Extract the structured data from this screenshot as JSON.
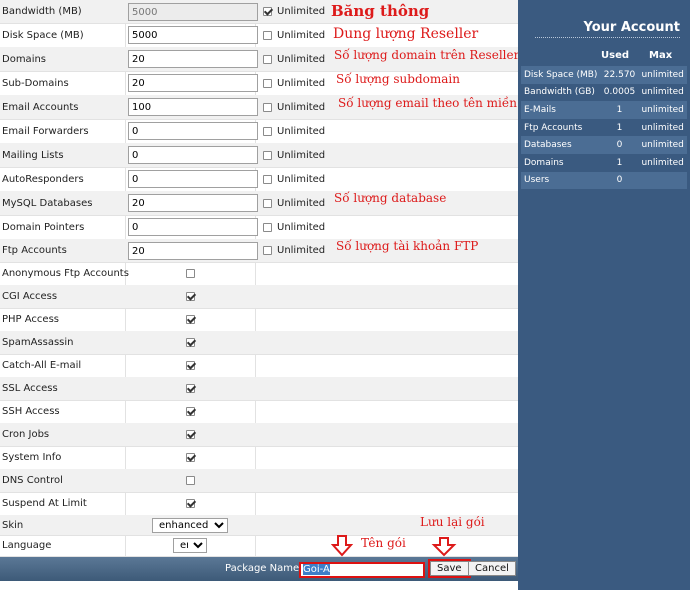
{
  "rows": [
    {
      "label": "Bandwidth (MB)",
      "value": "5000",
      "unlimited": "Unlimited",
      "checked": true,
      "disabled": true
    },
    {
      "label": "Disk Space (MB)",
      "value": "5000",
      "unlimited": "Unlimited",
      "checked": false
    },
    {
      "label": "Domains",
      "value": "20",
      "unlimited": "Unlimited",
      "checked": false
    },
    {
      "label": "Sub-Domains",
      "value": "20",
      "unlimited": "Unlimited",
      "checked": false
    },
    {
      "label": "Email Accounts",
      "value": "100",
      "unlimited": "Unlimited",
      "checked": false
    },
    {
      "label": "Email Forwarders",
      "value": "0",
      "unlimited": "Unlimited",
      "checked": false
    },
    {
      "label": "Mailing Lists",
      "value": "0",
      "unlimited": "Unlimited",
      "checked": false
    },
    {
      "label": "AutoResponders",
      "value": "0",
      "unlimited": "Unlimited",
      "checked": false
    },
    {
      "label": "MySQL Databases",
      "value": "20",
      "unlimited": "Unlimited",
      "checked": false
    },
    {
      "label": "Domain Pointers",
      "value": "0",
      "unlimited": "Unlimited",
      "checked": false
    },
    {
      "label": "Ftp Accounts",
      "value": "20",
      "unlimited": "Unlimited",
      "checked": false
    }
  ],
  "features": [
    {
      "label": "Anonymous Ftp Accounts",
      "checked": false
    },
    {
      "label": "CGI Access",
      "checked": true
    },
    {
      "label": "PHP Access",
      "checked": true
    },
    {
      "label": "SpamAssassin",
      "checked": true
    },
    {
      "label": "Catch-All E-mail",
      "checked": true
    },
    {
      "label": "SSL Access",
      "checked": true
    },
    {
      "label": "SSH Access",
      "checked": true
    },
    {
      "label": "Cron Jobs",
      "checked": true
    },
    {
      "label": "System Info",
      "checked": true
    },
    {
      "label": "DNS Control",
      "checked": false
    },
    {
      "label": "Suspend At Limit",
      "checked": true
    }
  ],
  "skin": {
    "label": "Skin",
    "value": "enhanced"
  },
  "language": {
    "label": "Language",
    "value": "en"
  },
  "bottom": {
    "package_label": "Package Name:",
    "package_value": "Goi-A",
    "save": "Save",
    "cancel": "Cancel"
  },
  "notes": {
    "bandwidth": "Băng thông",
    "disk": "Dung lượng Reseller",
    "domains": "Số lượng domain trên Reseller",
    "subdomains": "Số lượng subdomain",
    "email": "Số lượng email theo tên miền",
    "database": "Số lượng database",
    "ftp": "Số lượng tài khoản FTP",
    "save": "Lưu lại gói",
    "package": "Tên gói"
  },
  "account": {
    "title": "Your Account",
    "col_used": "Used",
    "col_max": "Max",
    "rows": [
      {
        "label": "Disk Space (MB)",
        "used": "22.570",
        "max": "unlimited"
      },
      {
        "label": "Bandwidth (GB)",
        "used": "0.0005",
        "max": "unlimited"
      },
      {
        "label": "E-Mails",
        "used": "1",
        "max": "unlimited"
      },
      {
        "label": "Ftp Accounts",
        "used": "1",
        "max": "unlimited"
      },
      {
        "label": "Databases",
        "used": "0",
        "max": "unlimited"
      },
      {
        "label": "Domains",
        "used": "1",
        "max": "unlimited"
      },
      {
        "label": "Users",
        "used": "0",
        "max": ""
      }
    ]
  },
  "colors": {
    "accent": "#3a5a80",
    "note": "#dd1a1a"
  }
}
